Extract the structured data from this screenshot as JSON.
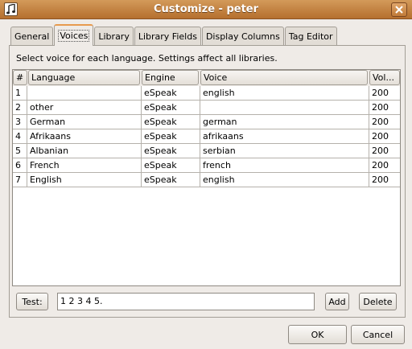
{
  "window": {
    "title": "Customize - peter"
  },
  "tabs": [
    {
      "label": "General"
    },
    {
      "label": "Voices"
    },
    {
      "label": "Library"
    },
    {
      "label": "Library Fields"
    },
    {
      "label": "Display Columns"
    },
    {
      "label": "Tag Editor"
    }
  ],
  "instruction": "Select voice for each language. Settings affect all libraries.",
  "table": {
    "headers": [
      "#",
      "Language",
      "Engine",
      "Voice",
      "Vol..."
    ],
    "rows": [
      [
        "1",
        "",
        "eSpeak",
        "english",
        "200"
      ],
      [
        "2",
        "other",
        "eSpeak",
        "",
        "200"
      ],
      [
        "3",
        "German",
        "eSpeak",
        "german",
        "200"
      ],
      [
        "4",
        "Afrikaans",
        "eSpeak",
        "afrikaans",
        "200"
      ],
      [
        "5",
        "Albanian",
        "eSpeak",
        "serbian",
        "200"
      ],
      [
        "6",
        "French",
        "eSpeak",
        "french",
        "200"
      ],
      [
        "7",
        "English",
        "eSpeak",
        "english",
        "200"
      ]
    ]
  },
  "test": {
    "button_label": "Test:",
    "input_value": "1 2 3 4 5."
  },
  "buttons": {
    "add": "Add",
    "delete": "Delete",
    "ok": "OK",
    "cancel": "Cancel"
  },
  "icons": {
    "app": "music-note-icon",
    "close": "close-icon"
  },
  "colors": {
    "titlebar": "#c4843f",
    "active_tab_accent": "#e79a4e",
    "background": "#efebe7"
  }
}
